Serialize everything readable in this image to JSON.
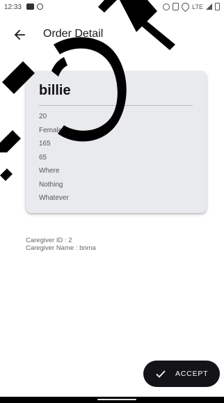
{
  "status_bar": {
    "time": "12:33",
    "network": "LTE"
  },
  "app_bar": {
    "title": "Order Detail",
    "back_icon": "arrow-left-icon"
  },
  "profile": {
    "name": "billie",
    "fields": [
      "20",
      "Female",
      "165",
      "65",
      "Where",
      "Nothing",
      "Whatever"
    ]
  },
  "caregiver": {
    "id_text": "Caregiver ID : 2",
    "name_text": "Caregiver Name : bnma"
  },
  "accept_button": {
    "label": "ACCEPT",
    "icon": "check-icon"
  },
  "colors": {
    "card_bg": "#e9eaee",
    "fab_bg": "#141418",
    "watermark": "#000000"
  }
}
